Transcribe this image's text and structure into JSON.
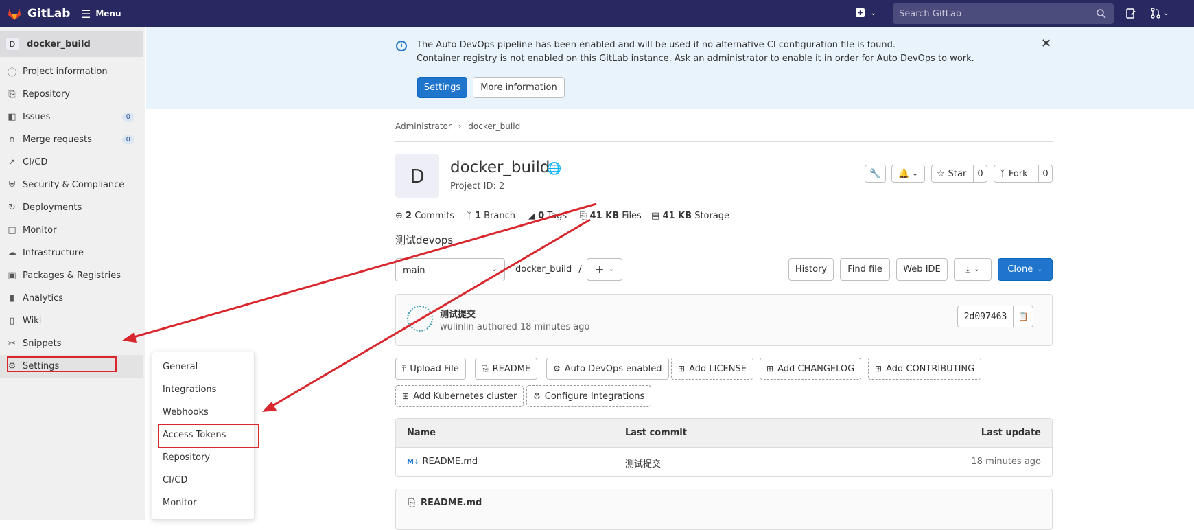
{
  "topbar": {
    "logo_text": "GitLab",
    "menu_label": "Menu",
    "search_placeholder": "Search GitLab"
  },
  "sidebar": {
    "project_avatar": "D",
    "project_name": "docker_build",
    "items": [
      {
        "label": "Project information",
        "icon": "info-icon"
      },
      {
        "label": "Repository",
        "icon": "file-icon"
      },
      {
        "label": "Issues",
        "icon": "issues-icon",
        "count": "0"
      },
      {
        "label": "Merge requests",
        "icon": "merge-request-icon",
        "count": "0"
      },
      {
        "label": "CI/CD",
        "icon": "rocket-icon"
      },
      {
        "label": "Security & Compliance",
        "icon": "shield-icon"
      },
      {
        "label": "Deployments",
        "icon": "deployments-icon"
      },
      {
        "label": "Monitor",
        "icon": "monitor-icon"
      },
      {
        "label": "Infrastructure",
        "icon": "cloud-icon"
      },
      {
        "label": "Packages & Registries",
        "icon": "package-icon"
      },
      {
        "label": "Analytics",
        "icon": "chart-icon"
      },
      {
        "label": "Wiki",
        "icon": "book-icon"
      },
      {
        "label": "Snippets",
        "icon": "scissors-icon"
      },
      {
        "label": "Settings",
        "icon": "gear-icon"
      }
    ]
  },
  "settings_flyout": {
    "items": [
      "General",
      "Integrations",
      "Webhooks",
      "Access Tokens",
      "Repository",
      "CI/CD",
      "Monitor"
    ]
  },
  "banner": {
    "line1": "The Auto DevOps pipeline has been enabled and will be used if no alternative CI configuration file is found.",
    "line2": "Container registry is not enabled on this GitLab instance. Ask an administrator to enable it in order for Auto DevOps to work.",
    "settings_label": "Settings",
    "more_label": "More information"
  },
  "breadcrumb": {
    "parent": "Administrator",
    "current": "docker_build"
  },
  "project": {
    "avatar": "D",
    "title": "docker_build",
    "id_text": "Project ID: 2",
    "star_label": "Star",
    "star_count": "0",
    "fork_label": "Fork",
    "fork_count": "0",
    "description": "测试devops"
  },
  "stats": {
    "commits_num": "2",
    "commits_label": "Commits",
    "branch_num": "1",
    "branch_label": "Branch",
    "tags_num": "0",
    "tags_label": "Tags",
    "files_num": "41 KB",
    "files_label": "Files",
    "storage_num": "41 KB",
    "storage_label": "Storage"
  },
  "repo_bar": {
    "branch": "main",
    "path": "docker_build",
    "path_sep": "/",
    "history": "History",
    "find_file": "Find file",
    "web_ide": "Web IDE",
    "clone": "Clone"
  },
  "last_commit": {
    "title": "测试提交",
    "meta": "wulinlin authored 18 minutes ago",
    "sha": "2d097463"
  },
  "quick_actions": [
    {
      "label": "Upload File",
      "style": "solid"
    },
    {
      "label": "README",
      "style": "solid"
    },
    {
      "label": "Auto DevOps enabled",
      "style": "solid"
    },
    {
      "label": "Add LICENSE",
      "style": "dashed"
    },
    {
      "label": "Add CHANGELOG",
      "style": "dashed"
    },
    {
      "label": "Add CONTRIBUTING",
      "style": "dashed"
    },
    {
      "label": "Add Kubernetes cluster",
      "style": "dashed"
    },
    {
      "label": "Configure Integrations",
      "style": "dashed"
    }
  ],
  "file_table": {
    "headers": {
      "name": "Name",
      "last_commit": "Last commit",
      "last_update": "Last update"
    },
    "rows": [
      {
        "name": "README.md",
        "commit": "测试提交",
        "updated": "18 minutes ago"
      }
    ]
  },
  "readme": {
    "title": "README.md"
  },
  "colors": {
    "topbar": "#292961",
    "accent": "#1f75cb",
    "annotation_red": "#d9272e",
    "banner_bg": "#e9f3fc"
  }
}
